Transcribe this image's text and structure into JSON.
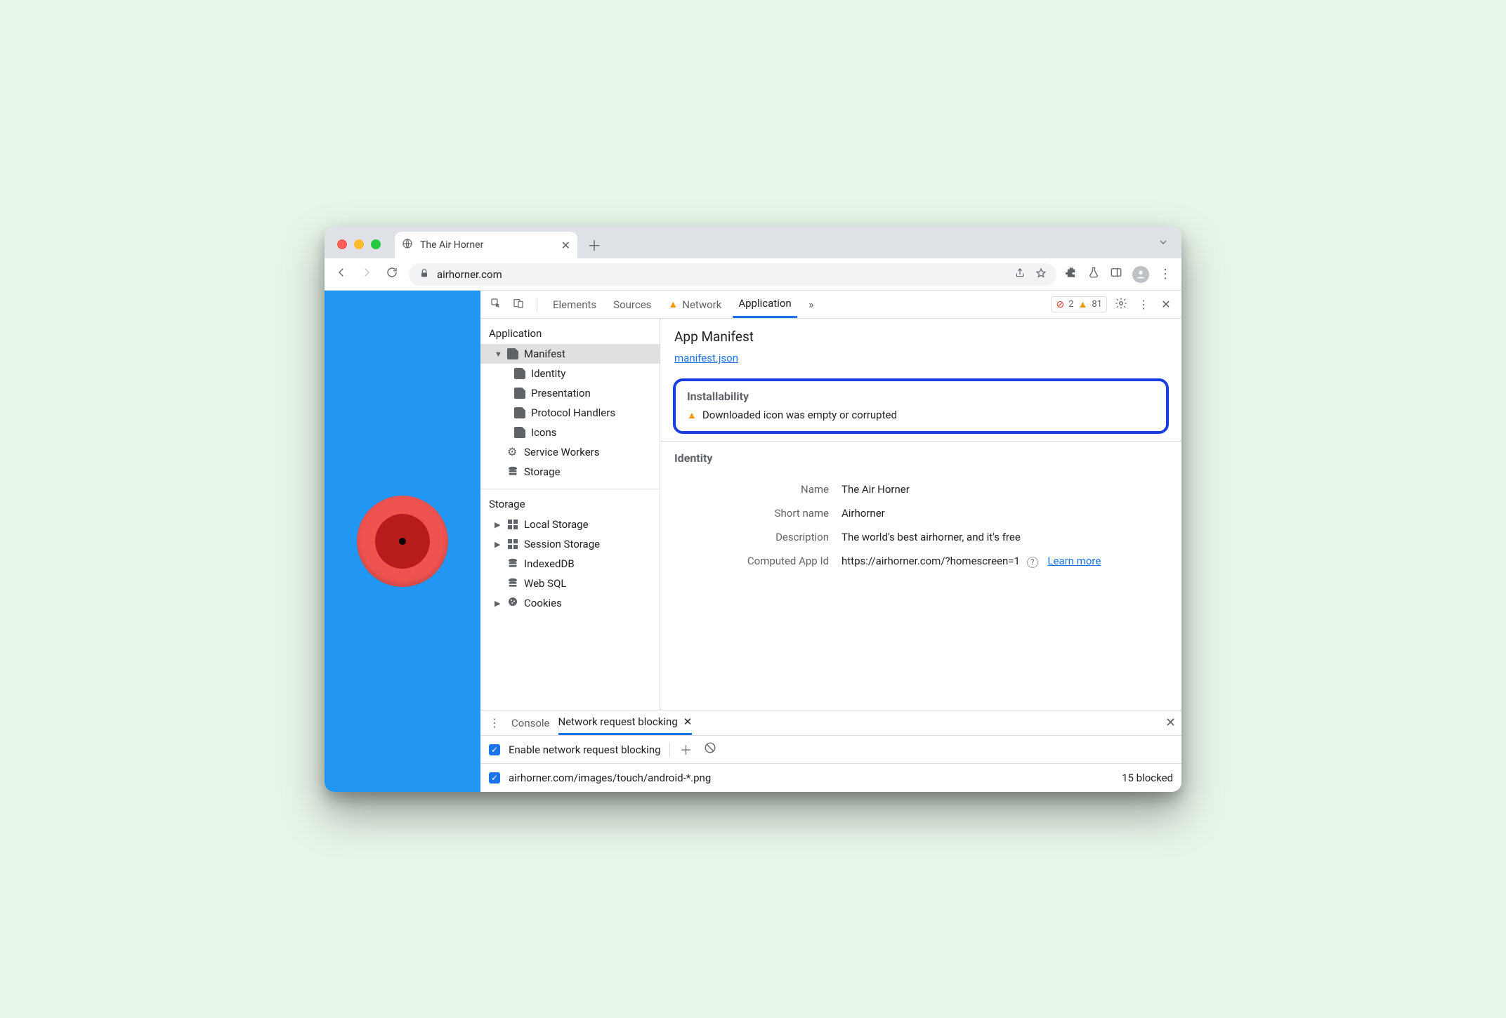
{
  "browser": {
    "tab_title": "The Air Horner",
    "url_host": "airhorner.com"
  },
  "devtools": {
    "tabs": [
      "Elements",
      "Sources",
      "Network",
      "Application"
    ],
    "active_tab": "Application",
    "errors": "2",
    "warnings": "81"
  },
  "sidebar": {
    "application": {
      "heading": "Application",
      "manifest": "Manifest",
      "children": [
        "Identity",
        "Presentation",
        "Protocol Handlers",
        "Icons"
      ],
      "service_workers": "Service Workers",
      "storage": "Storage"
    },
    "storage": {
      "heading": "Storage",
      "local": "Local Storage",
      "session": "Session Storage",
      "indexeddb": "IndexedDB",
      "websql": "Web SQL",
      "cookies": "Cookies"
    }
  },
  "manifest": {
    "title": "App Manifest",
    "link": "manifest.json",
    "installability_heading": "Installability",
    "install_msg": "Downloaded icon was empty or corrupted",
    "identity_heading": "Identity",
    "name_label": "Name",
    "name_value": "The Air Horner",
    "short_label": "Short name",
    "short_value": "Airhorner",
    "desc_label": "Description",
    "desc_value": "The world's best airhorner, and it's free",
    "appid_label": "Computed App Id",
    "appid_value": "https://airhorner.com/?homescreen=1",
    "learn_more": "Learn more"
  },
  "drawer": {
    "console": "Console",
    "netblock": "Network request blocking",
    "enable_label": "Enable network request blocking",
    "pattern": "airhorner.com/images/touch/android-*.png",
    "blocked_count": "15 blocked"
  }
}
